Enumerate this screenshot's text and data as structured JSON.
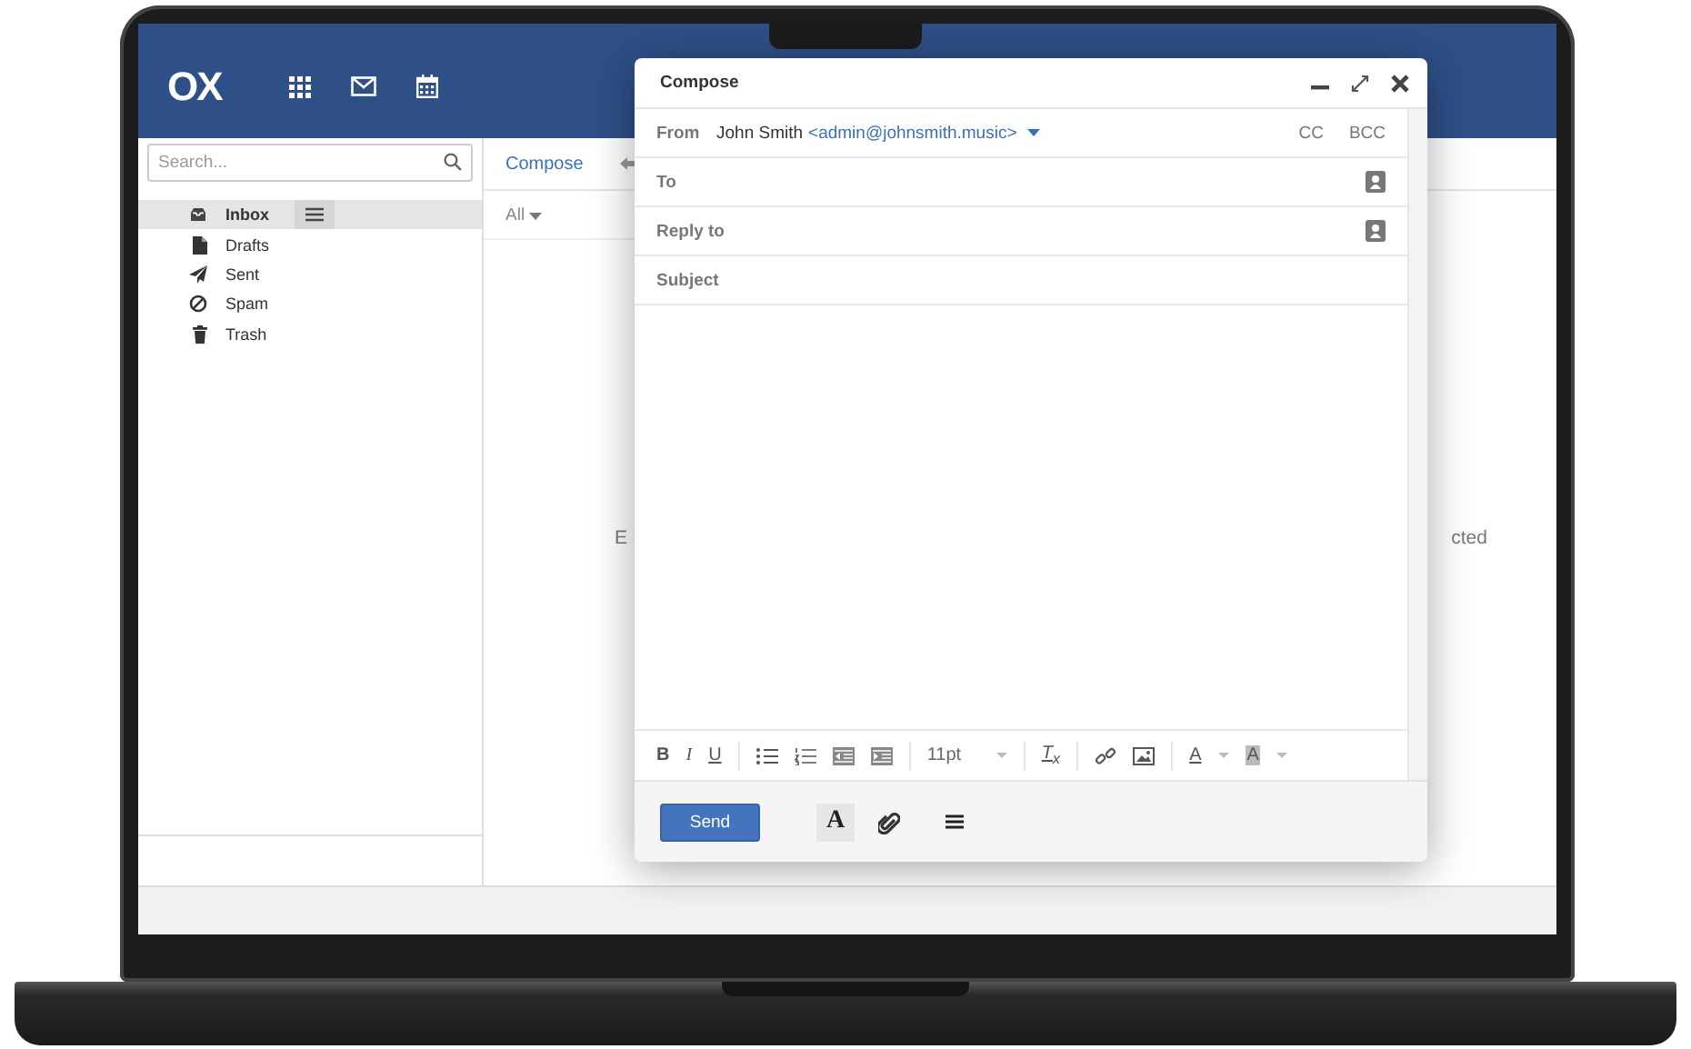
{
  "app": {
    "logo": "OX"
  },
  "search": {
    "placeholder": "Search..."
  },
  "folders": [
    {
      "label": "Inbox",
      "kind": "inbox",
      "selected": true
    },
    {
      "label": "Drafts",
      "kind": "drafts",
      "selected": false
    },
    {
      "label": "Sent",
      "kind": "sent",
      "selected": false
    },
    {
      "label": "Spam",
      "kind": "spam",
      "selected": false
    },
    {
      "label": "Trash",
      "kind": "trash",
      "selected": false
    }
  ],
  "list_toolbar": {
    "compose": "Compose",
    "filter": "All"
  },
  "reading_pane": {
    "text_left": "E",
    "text_right": "cted"
  },
  "compose": {
    "title": "Compose",
    "from_label": "From",
    "from_name": "John Smith",
    "from_address": "<admin@johnsmith.music>",
    "cc": "CC",
    "bcc": "BCC",
    "fields": [
      {
        "label": "To",
        "kind": "recipient"
      },
      {
        "label": "Reply to",
        "kind": "recipient"
      },
      {
        "label": "Subject",
        "kind": "text"
      }
    ],
    "format_buttons": [
      "B",
      "I",
      "U"
    ],
    "font_size": "11pt",
    "clear_format": "T$_{x}$",
    "text_color": "A",
    "background_color": "A",
    "send": "Send",
    "font_toggle": "A"
  }
}
